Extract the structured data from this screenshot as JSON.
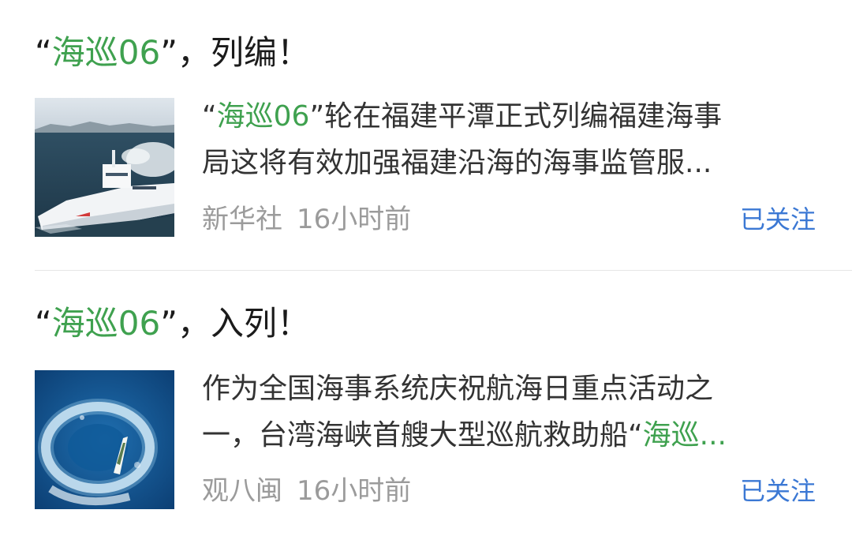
{
  "articles": [
    {
      "title": {
        "q_open": "“",
        "highlight": "海巡06",
        "rest": "”，列编！"
      },
      "summary": {
        "line1": {
          "q_open": "“",
          "highlight": "海巡06",
          "rest": "”轮在福建平潭正式列编福建海事"
        },
        "line2": "局这将有效加强福建沿海的海事监管服..."
      },
      "source": "新华社",
      "time": "16小时前",
      "follow_label": "已关注"
    },
    {
      "title": {
        "q_open": "“",
        "highlight": "海巡06",
        "rest": "”，入列！"
      },
      "summary": {
        "line1": "作为全国海事系统庆祝航海日重点活动之",
        "line2": {
          "before": "一，台湾海峡首艘大型巡航救助船“",
          "highlight": "海巡..."
        }
      },
      "source": "观八闽",
      "time": "16小时前",
      "follow_label": "已关注"
    }
  ],
  "colors": {
    "highlight": "#3fa14f",
    "follow": "#3b78d4",
    "meta": "#9b9b9b",
    "title": "#1b1b1b"
  }
}
